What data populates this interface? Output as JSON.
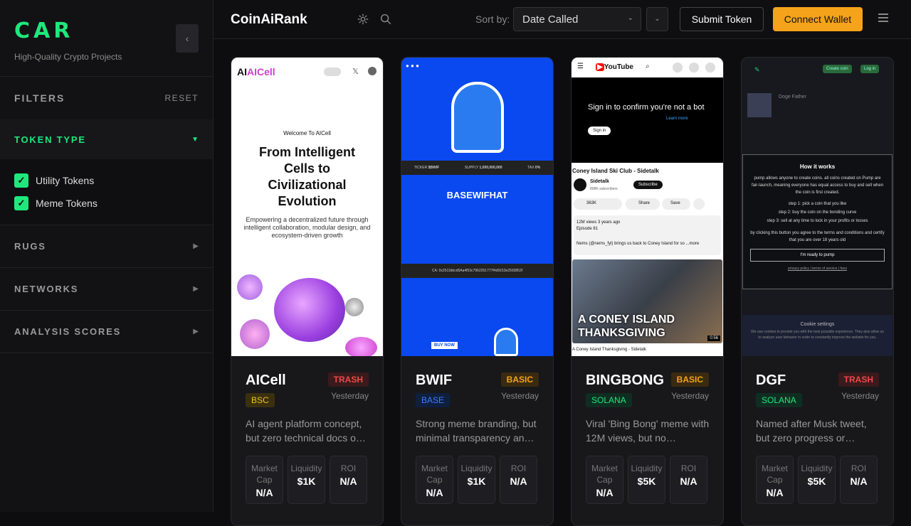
{
  "sidebar": {
    "brand": "CAR",
    "tagline": "High-Quality Crypto Projects",
    "collapse_icon": "‹",
    "filters_label": "FILTERS",
    "reset_label": "RESET",
    "sections": [
      {
        "label": "TOKEN TYPE",
        "arrow": "▼"
      },
      {
        "label": "RUGS",
        "arrow": "▶"
      },
      {
        "label": "NETWORKS",
        "arrow": "▶"
      },
      {
        "label": "ANALYSIS SCORES",
        "arrow": "▶"
      }
    ],
    "token_types": [
      {
        "label": "Utility Tokens",
        "checked": true
      },
      {
        "label": "Meme Tokens",
        "checked": true
      }
    ]
  },
  "header": {
    "logo": "CoinAiRank",
    "sort_label": "Sort by:",
    "sort_value": "Date Called",
    "submit_label": "Submit Token",
    "connect_label": "Connect Wallet"
  },
  "metric_labels": {
    "mcap": "Market Cap",
    "liq": "Liquidity",
    "roi": "ROI"
  },
  "cards": [
    {
      "name": "AICell",
      "rating": "TRASH",
      "chain": "BSC",
      "date": "Yesterday",
      "desc": "AI agent platform concept, but zero technical docs o…",
      "mcap": "N/A",
      "liq": "$1K",
      "roi": "N/A",
      "shot": {
        "logo": "AICell",
        "welcome": "Welcome To AICell",
        "headline": "From Intelligent Cells to Civilizational Evolution",
        "sub": "Empowering a decentralized future through intelligent collaboration, modular design, and ecosystem-driven growth"
      }
    },
    {
      "name": "BWIF",
      "rating": "BASIC",
      "chain": "BASE",
      "date": "Yesterday",
      "desc": "Strong meme branding, but minimal transparency an…",
      "mcap": "N/A",
      "liq": "$1K",
      "roi": "N/A",
      "shot": {
        "title": "BASEWIFHAT",
        "ticker_label": "TICKER",
        "ticker": "$BWIF",
        "supply_label": "SUPPLY",
        "supply": "1,000,000,000",
        "tax_label": "TAX",
        "tax": "0%",
        "ca": "CA: 0x2511bbcd5Aa4f53c7962251777f4d9153e2593852f",
        "buy": "BUY NOW"
      }
    },
    {
      "name": "BINGBONG",
      "rating": "BASIC",
      "chain": "SOLANA",
      "date": "Yesterday",
      "desc": "Viral 'Bing Bong' meme with 12M views, but no…",
      "mcap": "N/A",
      "liq": "$5K",
      "roi": "N/A",
      "shot": {
        "yt": "YouTube",
        "signin_msg": "Sign in to confirm you're not a bot",
        "learn": "Learn more",
        "signin": "Sign in",
        "video_title": "Coney Island Ski Club - Sidetalk",
        "channel": "Sidetalk",
        "subs": "808K subscribers",
        "subscribe": "Subscribe",
        "likes": "363K",
        "share": "Share",
        "save": "Save",
        "views": "12M views  3 years ago",
        "episode": "Episode 81",
        "snippet": "Nems (@nems_fyl) brings us back to Coney Island for so ...more",
        "thumb_text": "A CONEY ISLAND THANKSGIVING",
        "duration": "0:56",
        "caption": "A Coney Island Thanksgiving - Sidetalk"
      }
    },
    {
      "name": "DGF",
      "rating": "TRASH",
      "chain": "SOLANA",
      "date": "Yesterday",
      "desc": "Named after Musk tweet, but zero progress or…",
      "mcap": "N/A",
      "liq": "$5K",
      "roi": "N/A",
      "shot": {
        "title": "How it works",
        "p1": "pump allows anyone to create coins. all coins created on Pump are fair-launch, meaning everyone has equal access to buy and sell when the coin is first created.",
        "s1": "step 1: pick a coin that you like",
        "s2": "step 2: buy the coin on the bonding curve",
        "s3": "step 3: sell at any time to lock in your profits or losses",
        "p2": "by clicking this button you agree to the terms and conditions and certify that you are over 18 years old",
        "btn": "I'm ready to pump",
        "links": "privacy policy | terms of service | fees",
        "cookie_title": "Cookie settings",
        "cookie_text": "We use cookies to provide you with the best possible experience. They also allow us to analyze user behavior in order to constantly improve the website for you.",
        "create": "Create coin",
        "login": "Log in",
        "coin_name": "Doge Father"
      }
    }
  ]
}
